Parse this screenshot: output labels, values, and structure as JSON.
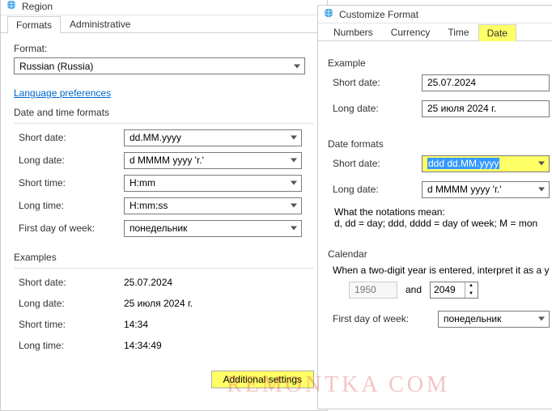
{
  "region_window": {
    "title": "Region",
    "tabs": {
      "formats": "Formats",
      "administrative": "Administrative"
    },
    "format_label": "Format:",
    "format_value": "Russian (Russia)",
    "lang_prefs": "Language preferences",
    "group_dtf": "Date and time formats",
    "rows": {
      "short_date_l": "Short date:",
      "short_date_v": "dd.MM.yyyy",
      "long_date_l": "Long date:",
      "long_date_v": "d MMMM yyyy 'r.'",
      "short_time_l": "Short time:",
      "short_time_v": "H:mm",
      "long_time_l": "Long time:",
      "long_time_v": "H:mm:ss",
      "fdow_l": "First day of week:",
      "fdow_v": "понедельник"
    },
    "group_ex": "Examples",
    "ex": {
      "short_date_l": "Short date:",
      "short_date_v": "25.07.2024",
      "long_date_l": "Long date:",
      "long_date_v": "25 июля 2024 г.",
      "short_time_l": "Short time:",
      "short_time_v": "14:34",
      "long_time_l": "Long time:",
      "long_time_v": "14:34:49"
    },
    "additional_btn": "Additional settings"
  },
  "customize_window": {
    "title": "Customize Format",
    "tabs": {
      "numbers": "Numbers",
      "currency": "Currency",
      "time": "Time",
      "date": "Date"
    },
    "group_example": "Example",
    "ex_short_l": "Short date:",
    "ex_short_v": "25.07.2024",
    "ex_long_l": "Long date:",
    "ex_long_v": "25 июля 2024 г.",
    "group_datefmt": "Date formats",
    "df_short_l": "Short date:",
    "df_short_v": "ddd dd.MM.yyyy",
    "df_long_l": "Long date:",
    "df_long_v": "d MMMM yyyy 'г.'",
    "notation_l": "What the notations mean:",
    "notation_v": "d, dd = day;  ddd, dddd = day of week;  M = mon",
    "group_cal": "Calendar",
    "cal_interpret": "When a two-digit year is entered, interpret it as a y",
    "cal_from": "1950",
    "cal_and": "and",
    "cal_to": "2049",
    "fdow_l": "First day of week:",
    "fdow_v": "понедельник"
  },
  "watermark": "REMONTKA         COM"
}
